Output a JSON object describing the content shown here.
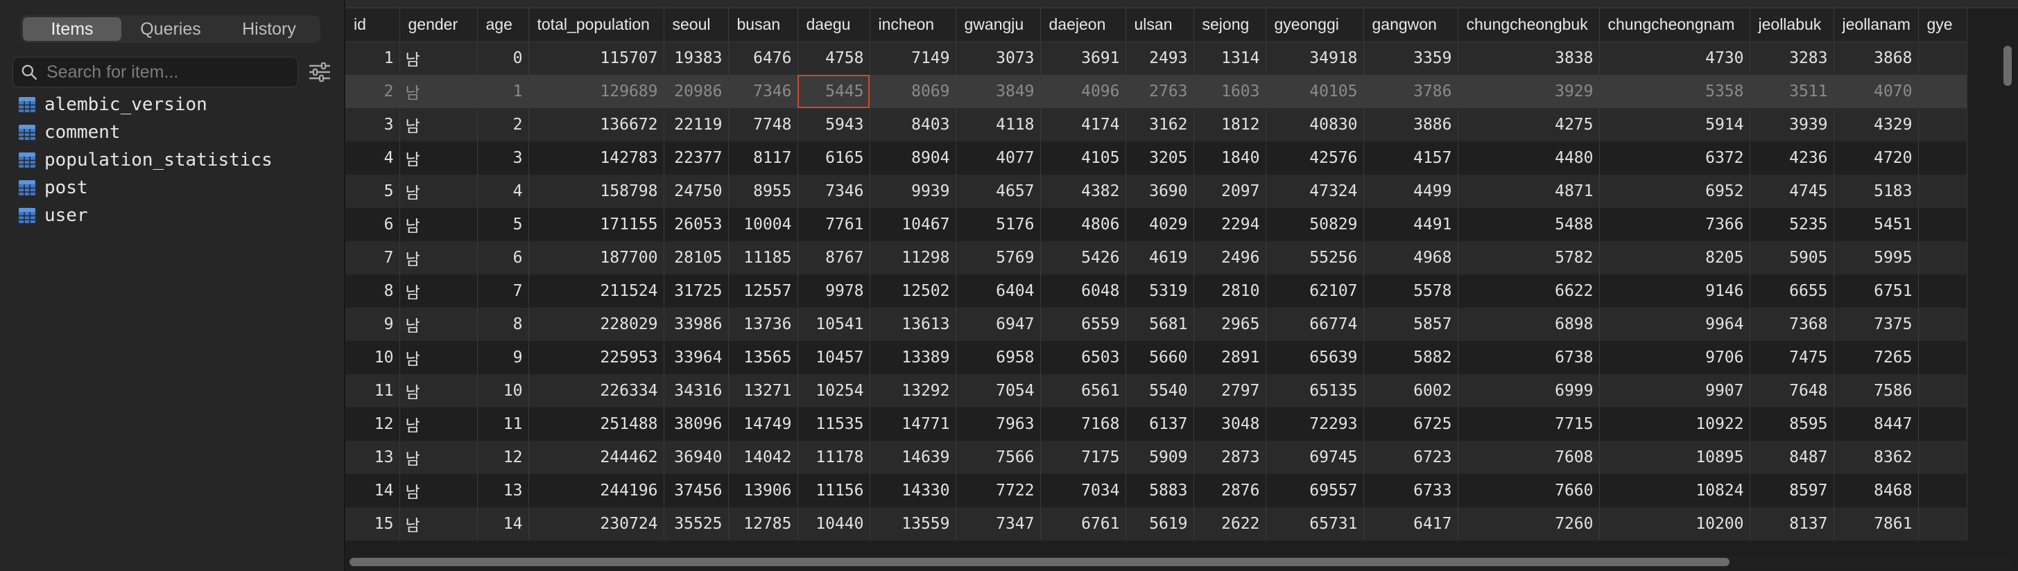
{
  "sidebar": {
    "tabs": [
      {
        "label": "Items",
        "active": true
      },
      {
        "label": "Queries",
        "active": false
      },
      {
        "label": "History",
        "active": false
      }
    ],
    "search": {
      "placeholder": "Search for item...",
      "value": ""
    },
    "items": [
      {
        "label": "alembic_version",
        "icon": "table-icon"
      },
      {
        "label": "comment",
        "icon": "table-icon"
      },
      {
        "label": "population_statistics",
        "icon": "table-icon"
      },
      {
        "label": "post",
        "icon": "table-icon"
      },
      {
        "label": "user",
        "icon": "table-icon"
      }
    ]
  },
  "grid": {
    "columns": [
      "id",
      "gender",
      "age",
      "total_population",
      "seoul",
      "busan",
      "daegu",
      "incheon",
      "gwangju",
      "daejeon",
      "ulsan",
      "sejong",
      "gyeonggi",
      "gangwon",
      "chungcheongbuk",
      "chungcheongnam",
      "jeollabuk",
      "jeollanam",
      "gye"
    ],
    "selected_row": 1,
    "focused_cell": {
      "row": 1,
      "col": 6
    },
    "accent_color": "#d0492c",
    "rows": [
      [
        "1",
        "남",
        "0",
        "115707",
        "19383",
        "6476",
        "4758",
        "7149",
        "3073",
        "3691",
        "2493",
        "1314",
        "34918",
        "3359",
        "3838",
        "4730",
        "3283",
        "3868",
        ""
      ],
      [
        "2",
        "남",
        "1",
        "129689",
        "20986",
        "7346",
        "5445",
        "8069",
        "3849",
        "4096",
        "2763",
        "1603",
        "40105",
        "3786",
        "3929",
        "5358",
        "3511",
        "4070",
        ""
      ],
      [
        "3",
        "남",
        "2",
        "136672",
        "22119",
        "7748",
        "5943",
        "8403",
        "4118",
        "4174",
        "3162",
        "1812",
        "40830",
        "3886",
        "4275",
        "5914",
        "3939",
        "4329",
        ""
      ],
      [
        "4",
        "남",
        "3",
        "142783",
        "22377",
        "8117",
        "6165",
        "8904",
        "4077",
        "4105",
        "3205",
        "1840",
        "42576",
        "4157",
        "4480",
        "6372",
        "4236",
        "4720",
        ""
      ],
      [
        "5",
        "남",
        "4",
        "158798",
        "24750",
        "8955",
        "7346",
        "9939",
        "4657",
        "4382",
        "3690",
        "2097",
        "47324",
        "4499",
        "4871",
        "6952",
        "4745",
        "5183",
        ""
      ],
      [
        "6",
        "남",
        "5",
        "171155",
        "26053",
        "10004",
        "7761",
        "10467",
        "5176",
        "4806",
        "4029",
        "2294",
        "50829",
        "4491",
        "5488",
        "7366",
        "5235",
        "5451",
        ""
      ],
      [
        "7",
        "남",
        "6",
        "187700",
        "28105",
        "11185",
        "8767",
        "11298",
        "5769",
        "5426",
        "4619",
        "2496",
        "55256",
        "4968",
        "5782",
        "8205",
        "5905",
        "5995",
        ""
      ],
      [
        "8",
        "남",
        "7",
        "211524",
        "31725",
        "12557",
        "9978",
        "12502",
        "6404",
        "6048",
        "5319",
        "2810",
        "62107",
        "5578",
        "6622",
        "9146",
        "6655",
        "6751",
        ""
      ],
      [
        "9",
        "남",
        "8",
        "228029",
        "33986",
        "13736",
        "10541",
        "13613",
        "6947",
        "6559",
        "5681",
        "2965",
        "66774",
        "5857",
        "6898",
        "9964",
        "7368",
        "7375",
        ""
      ],
      [
        "10",
        "남",
        "9",
        "225953",
        "33964",
        "13565",
        "10457",
        "13389",
        "6958",
        "6503",
        "5660",
        "2891",
        "65639",
        "5882",
        "6738",
        "9706",
        "7475",
        "7265",
        ""
      ],
      [
        "11",
        "남",
        "10",
        "226334",
        "34316",
        "13271",
        "10254",
        "13292",
        "7054",
        "6561",
        "5540",
        "2797",
        "65135",
        "6002",
        "6999",
        "9907",
        "7648",
        "7586",
        ""
      ],
      [
        "12",
        "남",
        "11",
        "251488",
        "38096",
        "14749",
        "11535",
        "14771",
        "7963",
        "7168",
        "6137",
        "3048",
        "72293",
        "6725",
        "7715",
        "10922",
        "8595",
        "8447",
        ""
      ],
      [
        "13",
        "남",
        "12",
        "244462",
        "36940",
        "14042",
        "11178",
        "14639",
        "7566",
        "7175",
        "5909",
        "2873",
        "69745",
        "6723",
        "7608",
        "10895",
        "8487",
        "8362",
        ""
      ],
      [
        "14",
        "남",
        "13",
        "244196",
        "37456",
        "13906",
        "11156",
        "14330",
        "7722",
        "7034",
        "5883",
        "2876",
        "69557",
        "6733",
        "7660",
        "10824",
        "8597",
        "8468",
        ""
      ],
      [
        "15",
        "남",
        "14",
        "230724",
        "35525",
        "12785",
        "10440",
        "13559",
        "7347",
        "6761",
        "5619",
        "2622",
        "65731",
        "6417",
        "7260",
        "10200",
        "8137",
        "7861",
        ""
      ]
    ]
  }
}
